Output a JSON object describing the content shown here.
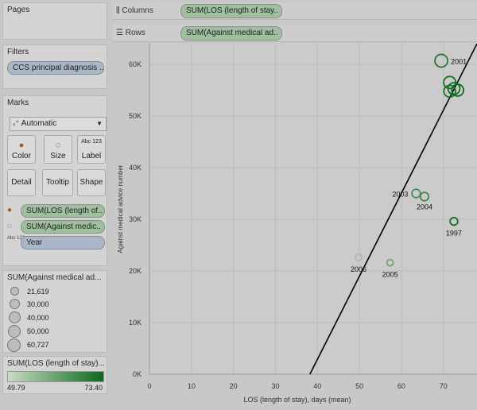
{
  "sidebar": {
    "pages_title": "Pages",
    "filters_title": "Filters",
    "filter_pill": "CCS principal diagnosis ..",
    "marks_title": "Marks",
    "mark_type": "Automatic",
    "buttons": {
      "color": "Color",
      "size": "Size",
      "label": "Label",
      "detail": "Detail",
      "tooltip": "Tooltip",
      "shape": "Shape"
    },
    "abc_icon_text": "Abc 123",
    "mark_pills": {
      "color": "SUM(LOS (length of..",
      "size": "SUM(Against medic..",
      "label": "Year"
    },
    "size_legend": {
      "title": "SUM(Against medical ad...",
      "items": [
        "21,619",
        "30,000",
        "40,000",
        "50,000",
        "60,727"
      ]
    },
    "color_legend": {
      "title": "SUM(LOS (length of stay)...",
      "min": "49.79",
      "max": "73.40"
    }
  },
  "shelves": {
    "columns_label": "Columns",
    "columns_pill": "SUM(LOS (length of stay..",
    "rows_label": "Rows",
    "rows_pill": "SUM(Against medical ad.."
  },
  "chart_data": {
    "type": "scatter",
    "xlabel": "LOS (length of stay), days (mean)",
    "ylabel": "Against medical advice number",
    "xlim": [
      0,
      78
    ],
    "ylim": [
      0,
      64000
    ],
    "x_ticks": [
      0,
      10,
      20,
      30,
      40,
      50,
      60,
      70
    ],
    "y_ticks": [
      "0K",
      "10K",
      "20K",
      "30K",
      "40K",
      "50K",
      "60K"
    ],
    "grid": true,
    "points": [
      {
        "year": "2001",
        "x": 69.5,
        "y": 60700,
        "label": "2001"
      },
      {
        "year": "",
        "x": 71.5,
        "y": 56500,
        "label": ""
      },
      {
        "year": "",
        "x": 71.5,
        "y": 54800,
        "label": ""
      },
      {
        "year": "",
        "x": 72.5,
        "y": 55300,
        "label": ""
      },
      {
        "year": "",
        "x": 73.4,
        "y": 55000,
        "label": ""
      },
      {
        "year": "2003",
        "x": 63.5,
        "y": 35000,
        "label": "2003"
      },
      {
        "year": "2004",
        "x": 65.5,
        "y": 34400,
        "label": "2004"
      },
      {
        "year": "1997",
        "x": 72.5,
        "y": 29600,
        "label": "1997"
      },
      {
        "year": "2006",
        "x": 49.8,
        "y": 22600,
        "label": "2006"
      },
      {
        "year": "2005",
        "x": 57.3,
        "y": 21600,
        "label": "2005"
      }
    ],
    "trend_line": {
      "x": [
        38.2,
        78
      ],
      "y": [
        0,
        64000
      ]
    }
  }
}
